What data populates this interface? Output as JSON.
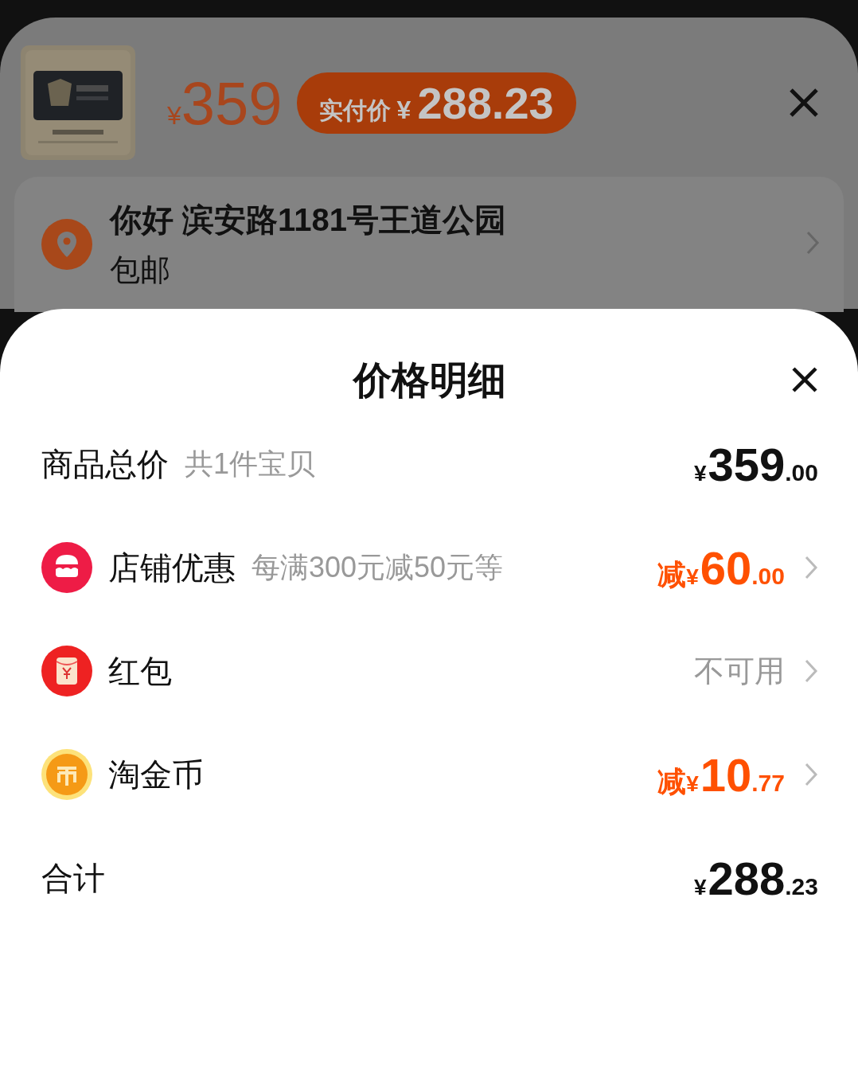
{
  "product": {
    "price": {
      "currency": "¥",
      "amount": "359"
    },
    "paid_badge": {
      "label": "实付价",
      "currency": "¥",
      "amount": "288.23"
    }
  },
  "address": {
    "name_line": "你好 滨安路1181号王道公园",
    "shipping": "包邮",
    "has_arrow": true
  },
  "sheet": {
    "title": "价格明细",
    "rows": [
      {
        "kind": "subtotal",
        "label": "商品总价",
        "note": "共1件宝贝",
        "currency": "¥",
        "integer": "359",
        "decimal": ".00",
        "has_arrow": false
      },
      {
        "kind": "store",
        "label": "店铺优惠",
        "note": "每满300元减50元等",
        "prefix": "减",
        "currency": "¥",
        "integer": "60",
        "decimal": ".00",
        "has_arrow": true
      },
      {
        "kind": "packet",
        "label": "红包",
        "text": "不可用",
        "has_arrow": true
      },
      {
        "kind": "coin",
        "label": "淘金币",
        "prefix": "减",
        "currency": "¥",
        "integer": "10",
        "decimal": ".77",
        "has_arrow": true
      },
      {
        "kind": "total",
        "label": "合计",
        "currency": "¥",
        "integer": "288",
        "decimal": ".23",
        "has_arrow": false
      }
    ]
  }
}
